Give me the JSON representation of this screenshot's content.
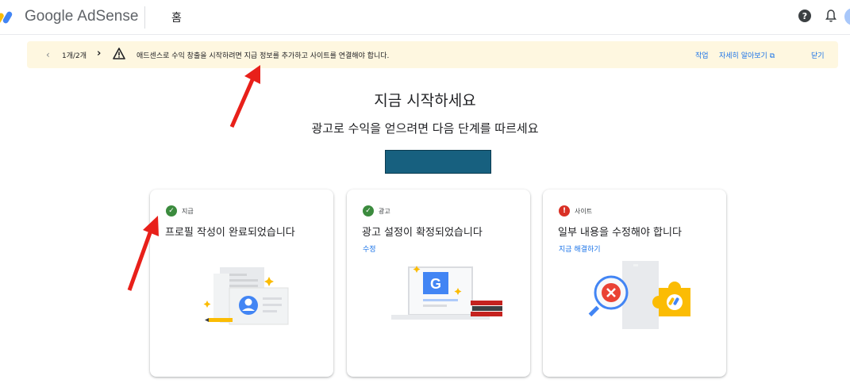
{
  "header": {
    "brand_google": "Google",
    "brand_product": "AdSense",
    "home_label": "홈",
    "help_icon": "help-icon",
    "bell_icon": "notifications-icon"
  },
  "banner": {
    "pager": "1개/2개",
    "message": "애드센스로 수익 창출을 시작하려면 지급 정보를 추가하고 사이트를 연결해야 합니다.",
    "action_task": "작업",
    "action_learn": "자세히 알아보기",
    "action_close": "닫기"
  },
  "main": {
    "heading": "지금 시작하세요",
    "subheading": "광고로 수익을 얻으려면 다음 단계를 따르세요"
  },
  "cards": [
    {
      "status_label": "지급",
      "status": "ok",
      "title": "프로필 작성이 완료되었습니다",
      "link": ""
    },
    {
      "status_label": "광고",
      "status": "ok",
      "title": "광고 설정이 확정되었습니다",
      "link": "수정"
    },
    {
      "status_label": "사이트",
      "status": "error",
      "title": "일부 내용을 수정해야 합니다",
      "link": "지금 해결하기"
    }
  ],
  "colors": {
    "banner_bg": "#fef7e0",
    "link": "#1a73e8",
    "ok": "#3b8b3e",
    "error": "#d93025",
    "cta": "#17607f",
    "annotation_arrow": "#e8201a"
  }
}
